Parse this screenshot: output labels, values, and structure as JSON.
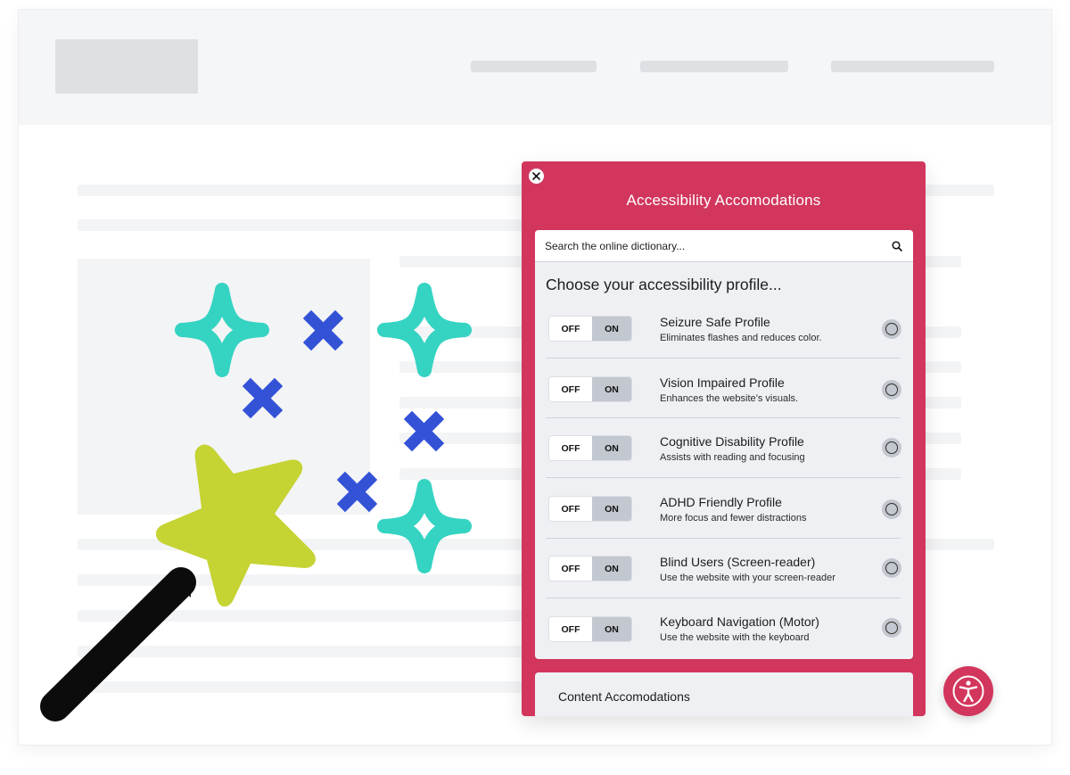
{
  "widget": {
    "title": "Accessibility Accomodations",
    "search": {
      "placeholder": "Search the online dictionary..."
    },
    "heading": "Choose your accessibility profile...",
    "toggle": {
      "off_label": "OFF",
      "on_label": "ON"
    },
    "profiles": [
      {
        "name": "Seizure Safe Profile",
        "description": "Eliminates flashes and reduces color."
      },
      {
        "name": "Vision Impaired Profile",
        "description": "Enhances the website’s visuals."
      },
      {
        "name": "Cognitive Disability Profile",
        "description": "Assists with reading and focusing"
      },
      {
        "name": "ADHD Friendly Profile",
        "description": "More focus and fewer distractions"
      },
      {
        "name": "Blind Users (Screen-reader)",
        "description": "Use the website with your screen-reader"
      },
      {
        "name": "Keyboard Navigation (Motor)",
        "description": "Use the website with the keyboard"
      }
    ],
    "content_section": "Content Accomodations"
  },
  "icons": {
    "close": "close-icon",
    "search": "search-icon",
    "accessibility": "accessibility-person-icon",
    "wand": "magic-wand-icon",
    "star": "star-icon",
    "sparkle": "sparkle-icon",
    "cross": "cross-icon"
  },
  "colors": {
    "accent": "#d2365d",
    "panel": "#eef0f4",
    "sparkle": "#35d3c2",
    "cross": "#3352d6",
    "star": "#c5d333",
    "wand": "#0c0c0c"
  }
}
